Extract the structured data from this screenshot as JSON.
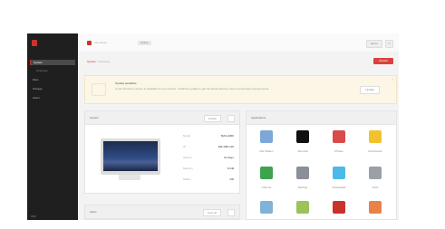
{
  "sidebar": {
    "items": [
      {
        "label": "System",
        "active": true
      },
      {
        "label": "Overview",
        "sub": true
      },
      {
        "label": "Files"
      },
      {
        "label": "Storage"
      },
      {
        "label": "Users"
      }
    ]
  },
  "topbar": {
    "host": "nas-server",
    "host_pill": "Online",
    "user_button": "admin",
    "power": "⏻"
  },
  "breadcrumb": {
    "root": "System",
    "sep": "/",
    "current": "Overview"
  },
  "action_button": "Restart",
  "notice": {
    "title": "Update available",
    "text": "A new firmware version is available for your device. Install the update to get the latest features, fixes and security improvements.",
    "button": "Update",
    "close": "×"
  },
  "system_card": {
    "title": "System",
    "control": "Details",
    "info": [
      {
        "k": "Model",
        "v": "NAS-4200"
      },
      {
        "k": "IP",
        "v": "192.168.1.20"
      },
      {
        "k": "Uptime",
        "v": "12 days"
      },
      {
        "k": "Memory",
        "v": "8 GB"
      },
      {
        "k": "Status",
        "v": "OK"
      }
    ]
  },
  "second_card": {
    "title": "Alerts",
    "control": "View all"
  },
  "apps_card": {
    "title": "Applications",
    "apps": [
      {
        "label": "File Station",
        "color": "#7da7d9",
        "icon": "file-station-icon"
      },
      {
        "label": "Terminal",
        "color": "#111111",
        "icon": "terminal-icon"
      },
      {
        "label": "Photos",
        "color": "#d94b4b",
        "icon": "photos-icon"
      },
      {
        "label": "Documents",
        "color": "#f2c12e",
        "icon": "folder-icon"
      },
      {
        "label": "Chrome",
        "color": "#3fa34d",
        "icon": "chrome-icon"
      },
      {
        "label": "Settings",
        "color": "#8a8f98",
        "icon": "settings-icon"
      },
      {
        "label": "Downloads",
        "color": "#4cb9e8",
        "icon": "downloads-icon"
      },
      {
        "label": "Tools",
        "color": "#9aa0a6",
        "icon": "tools-icon"
      },
      {
        "label": "",
        "color": "#7fb4d8",
        "icon": "cloud-icon"
      },
      {
        "label": "",
        "color": "#9bc35a",
        "icon": "leaf-icon"
      },
      {
        "label": "",
        "color": "#c8332e",
        "icon": "arc-icon"
      },
      {
        "label": "",
        "color": "#e8824a",
        "icon": "box-icon"
      }
    ]
  }
}
